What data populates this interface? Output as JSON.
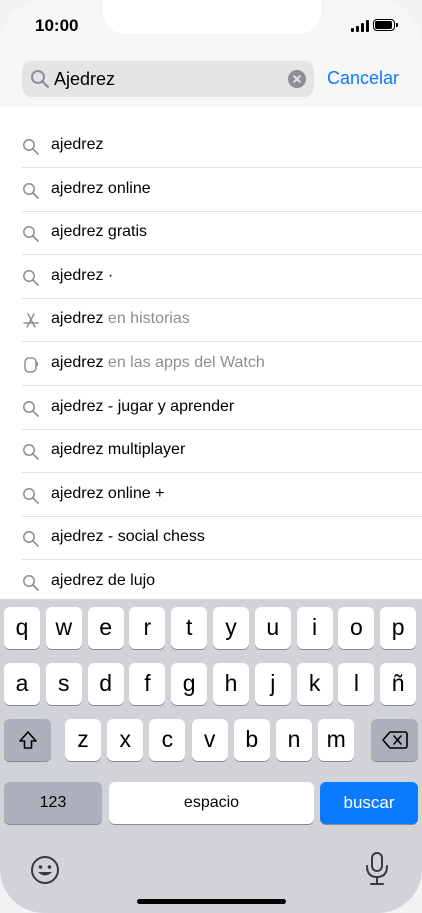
{
  "status": {
    "time": "10:00"
  },
  "search": {
    "value": "Ajedrez",
    "cancel_label": "Cancelar"
  },
  "suggestions": [
    {
      "query": "ajedrez",
      "suffix": "",
      "icon": "search-icon"
    },
    {
      "query": "ajedrez online",
      "suffix": "",
      "icon": "search-icon"
    },
    {
      "query": "ajedrez gratis",
      "suffix": "",
      "icon": "search-icon"
    },
    {
      "query": "ajedrez ·",
      "suffix": "",
      "icon": "search-icon"
    },
    {
      "query": "ajedrez",
      "suffix": " en historias",
      "icon": "app-store-icon"
    },
    {
      "query": "ajedrez",
      "suffix": " en las apps del Watch",
      "icon": "watch-icon"
    },
    {
      "query": "ajedrez - jugar y aprender",
      "suffix": "",
      "icon": "search-icon"
    },
    {
      "query": "ajedrez multiplayer",
      "suffix": "",
      "icon": "search-icon"
    },
    {
      "query": "ajedrez online +",
      "suffix": "",
      "icon": "search-icon"
    },
    {
      "query": "ajedrez - social chess",
      "suffix": "",
      "icon": "search-icon"
    },
    {
      "query": "ajedrez de lujo",
      "suffix": "",
      "icon": "search-icon"
    }
  ],
  "keyboard": {
    "row1": [
      "q",
      "w",
      "e",
      "r",
      "t",
      "y",
      "u",
      "i",
      "o",
      "p"
    ],
    "row2": [
      "a",
      "s",
      "d",
      "f",
      "g",
      "h",
      "j",
      "k",
      "l",
      "ñ"
    ],
    "row3": [
      "z",
      "x",
      "c",
      "v",
      "b",
      "n",
      "m"
    ],
    "numbers_label": "123",
    "space_label": "espacio",
    "search_label": "buscar",
    "accent_color": "#0a7aff"
  }
}
